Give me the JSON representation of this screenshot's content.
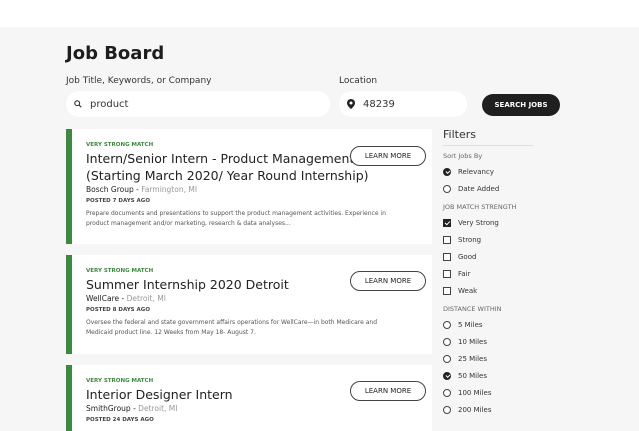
{
  "header": {
    "title": "Job Board"
  },
  "search": {
    "keywords_label": "Job Title, Keywords, or Company",
    "keywords_value": "product",
    "location_label": "Location",
    "location_value": "48239",
    "button_label": "SEARCH JOBS"
  },
  "jobs": [
    {
      "match": "VERY STRONG MATCH",
      "title_line1": "Intern/Senior Intern - Product Management",
      "title_line2": "(Starting March 2020/ Year Round Internship)",
      "company": "Bosch Group",
      "location": "Farmington, MI",
      "posted": "POSTED 7 DAYS AGO",
      "desc_line1": "Prepare documents and presentations to support the product management activities. Experience in",
      "desc_line2": "product management and/or marketing, research & data analyses...",
      "button": "LEARN MORE"
    },
    {
      "match": "VERY STRONG MATCH",
      "title_line1": "Summer Internship 2020 Detroit",
      "company": "WellCare",
      "location": "Detroit, MI",
      "posted": "POSTED 8 DAYS AGO",
      "desc_line1": "Oversee the federal and state government affairs operations for WellCare—in both Medicare and",
      "desc_line2": "Medicaid product line. 12 Weeks from May 18- August 7.",
      "button": "LEARN MORE"
    },
    {
      "match": "VERY STRONG MATCH",
      "title_line1": "Interior Designer Intern",
      "company": "SmithGroup",
      "location": "Detroit, MI",
      "posted": "POSTED 24 DAYS AGO",
      "button": "LEARN MORE"
    }
  ],
  "filters": {
    "title": "Filters",
    "sort_heading": "Sort Jobs By",
    "sort_options": [
      {
        "label": "Relevancy",
        "selected": true
      },
      {
        "label": "Date Added",
        "selected": false
      }
    ],
    "strength_heading": "JOB MATCH STRENGTH",
    "strength_options": [
      {
        "label": "Very Strong",
        "checked": true
      },
      {
        "label": "Strong",
        "checked": false
      },
      {
        "label": "Good",
        "checked": false
      },
      {
        "label": "Fair",
        "checked": false
      },
      {
        "label": "Weak",
        "checked": false
      }
    ],
    "distance_heading": "DISTANCE WITHIN",
    "distance_options": [
      {
        "label": "5 Miles",
        "selected": false
      },
      {
        "label": "10 Miles",
        "selected": false
      },
      {
        "label": "25 Miles",
        "selected": false
      },
      {
        "label": "50 Miles",
        "selected": true
      },
      {
        "label": "100 Miles",
        "selected": false
      },
      {
        "label": "200 Miles",
        "selected": false
      }
    ]
  },
  "colors": {
    "accent": "#3c8a3f",
    "button": "#1f1f1f",
    "background": "#f6f6f6"
  }
}
